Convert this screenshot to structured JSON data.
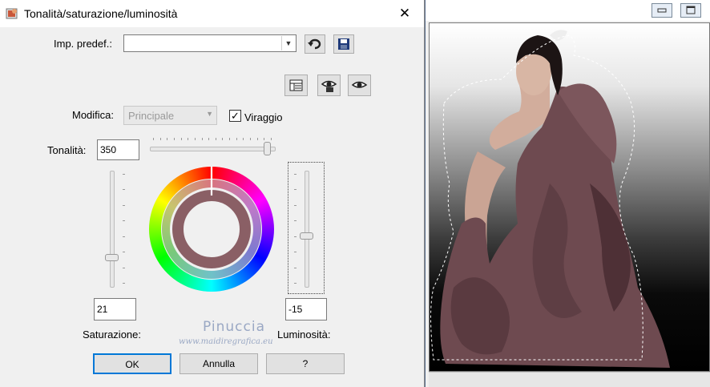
{
  "dialog": {
    "title": "Tonalità/saturazione/luminosità",
    "preset_label": "Imp. predef.:",
    "preset_value": "",
    "modifica_label": "Modifica:",
    "modifica_value": "Principale",
    "viraggio_label": "Viraggio",
    "viraggio_checked": true,
    "tonalita_label": "Tonalità:",
    "tonalita_value": "350",
    "saturazione_label": "Saturazione:",
    "saturazione_value": "21",
    "luminosita_label": "Luminosità:",
    "luminosita_value": "-15",
    "buttons": {
      "ok": "OK",
      "cancel": "Annulla",
      "help": "?"
    },
    "sliders": {
      "hue_fraction": 0.97,
      "saturation_fraction": 0.76,
      "lightness_fraction": 0.56
    },
    "colors": {
      "ring_color": "#8a5f65",
      "focus_border": "#0078d7"
    },
    "icons": [
      "dialog-icon",
      "reset-preset-icon",
      "save-preset-icon",
      "layout-icon",
      "preview-on-image-icon",
      "preview-icon"
    ]
  },
  "watermark": {
    "name": "Pinuccia",
    "site": "www.maidiregrafica.eu"
  },
  "image_window": {
    "icons": [
      "minimize-icon",
      "maximize-icon"
    ],
    "subject_color": "#6e4a50"
  }
}
